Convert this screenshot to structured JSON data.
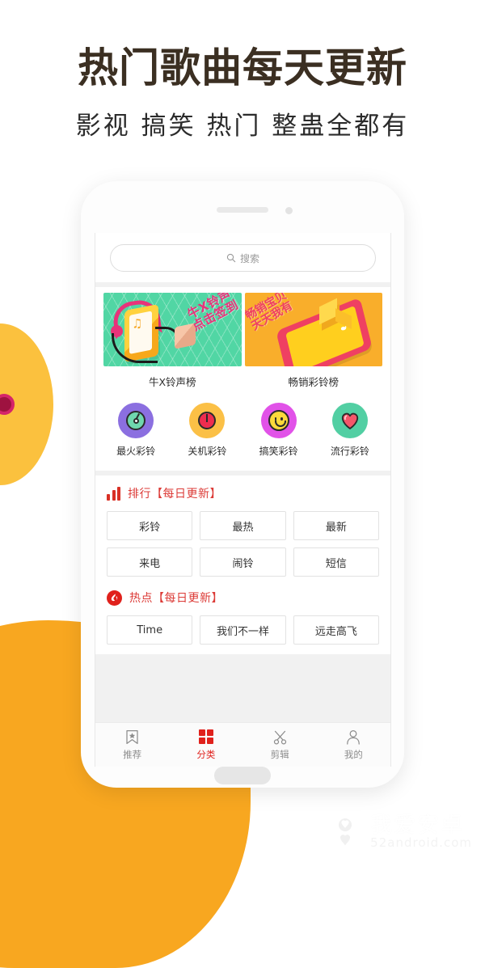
{
  "promo": {
    "headline": "热门歌曲每天更新",
    "subheadline": "影视 搞笑 热门 整蛊全都有"
  },
  "app": {
    "search": {
      "icon": "search-icon",
      "placeholder": "搜索"
    },
    "banners": [
      {
        "label": "牛X铃声榜",
        "art_text": "牛X铃声\n点击签到",
        "bg_color": "#51d6a4"
      },
      {
        "label": "畅销彩铃榜",
        "art_text": "畅销宝贝\n天天我有",
        "bg_color": "#f9ae2b"
      }
    ],
    "categories": [
      {
        "label": "最火彩铃",
        "icon": "vinyl-disc-icon",
        "circle_color": "#8b6fe0"
      },
      {
        "label": "关机彩铃",
        "icon": "power-icon",
        "circle_color": "#fbc046"
      },
      {
        "label": "搞笑彩铃",
        "icon": "smiley-icon",
        "circle_color": "#e152e8"
      },
      {
        "label": "流行彩铃",
        "icon": "heart-icon",
        "circle_color": "#52cfa3"
      }
    ],
    "sections": [
      {
        "icon": "bar-chart-icon",
        "title": "排行【每日更新】",
        "tags": [
          "彩铃",
          "最热",
          "最新",
          "来电",
          "闹铃",
          "短信"
        ]
      },
      {
        "icon": "flame-icon",
        "title": "热点【每日更新】",
        "tags": [
          "Time",
          "我们不一样",
          "远走高飞"
        ]
      }
    ],
    "tabs": [
      {
        "label": "推荐",
        "icon": "bookmark-star-icon",
        "active": false
      },
      {
        "label": "分类",
        "icon": "grid-icon",
        "active": true
      },
      {
        "label": "剪辑",
        "icon": "scissors-icon",
        "active": false
      },
      {
        "label": "我的",
        "icon": "person-icon",
        "active": false
      }
    ],
    "accent_color": "#e0211c"
  },
  "watermark": {
    "logo": "android-robot-icon",
    "name": "我爱安卓",
    "site": "52android.com"
  }
}
